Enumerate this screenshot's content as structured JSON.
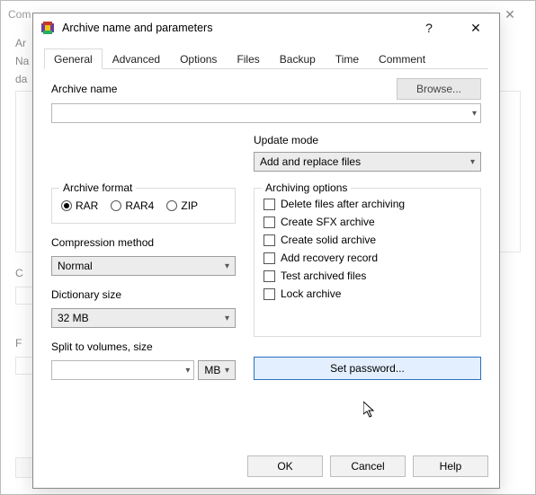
{
  "background": {
    "title_fragment": "Com",
    "label_name_fragment": "Na",
    "label_data_fragment": "da",
    "side_c": "C",
    "side_f": "F"
  },
  "modal": {
    "title": "Archive name and parameters",
    "help_glyph": "?",
    "close_glyph": "✕",
    "tabs": {
      "general": "General",
      "advanced": "Advanced",
      "options": "Options",
      "files": "Files",
      "backup": "Backup",
      "time": "Time",
      "comment": "Comment"
    },
    "archive_name_label": "Archive name",
    "browse_label": "Browse...",
    "archive_name_value": "",
    "update_mode_label": "Update mode",
    "update_mode_value": "Add and replace files",
    "archive_format": {
      "legend": "Archive format",
      "rar": "RAR",
      "rar4": "RAR4",
      "zip": "ZIP"
    },
    "compression_method_label": "Compression method",
    "compression_method_value": "Normal",
    "dictionary_size_label": "Dictionary size",
    "dictionary_size_value": "32 MB",
    "split_label": "Split to volumes, size",
    "split_value": "",
    "split_unit": "MB",
    "archiving_options": {
      "legend": "Archiving options",
      "delete_after": "Delete files after archiving",
      "sfx": "Create SFX archive",
      "solid": "Create solid archive",
      "recovery": "Add recovery record",
      "test": "Test archived files",
      "lock": "Lock archive"
    },
    "set_password_label": "Set password...",
    "buttons": {
      "ok": "OK",
      "cancel": "Cancel",
      "help": "Help"
    }
  }
}
